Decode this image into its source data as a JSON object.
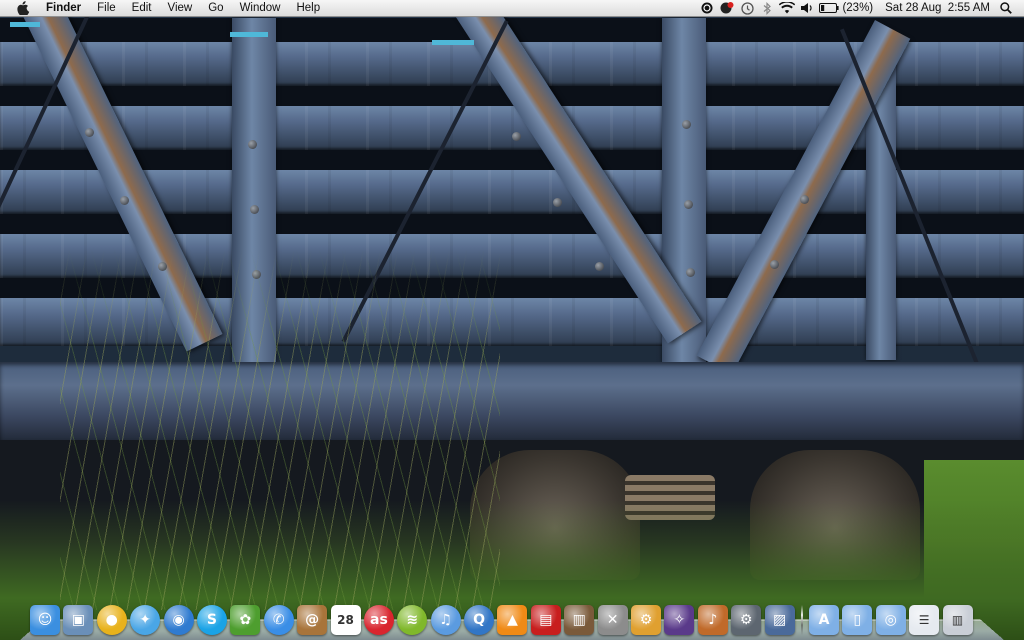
{
  "menubar": {
    "apple_icon": "apple-icon",
    "app_name": "Finder",
    "menus": [
      "File",
      "Edit",
      "View",
      "Go",
      "Window",
      "Help"
    ],
    "status_icons": [
      "record-icon",
      "alert-badge-icon",
      "time-machine-icon",
      "bluetooth-icon",
      "wifi-icon",
      "volume-icon"
    ],
    "battery_text": "(23%)",
    "battery_level": 0.23,
    "datetime": "Sat 28 Aug  2:55 AM",
    "spotlight_icon": "spotlight-icon"
  },
  "dock": {
    "apps": [
      {
        "icon": "finder-icon",
        "glyph": "☺",
        "bg": "#3b8fe0"
      },
      {
        "icon": "preview-icon",
        "glyph": "▣",
        "bg": "#6a8fb8"
      },
      {
        "icon": "chrome-icon",
        "glyph": "●",
        "bg": "#e8b21c"
      },
      {
        "icon": "safari-icon",
        "glyph": "✦",
        "bg": "#4aa6e6"
      },
      {
        "icon": "browser-globe-icon",
        "glyph": "◉",
        "bg": "#2f7bd0"
      },
      {
        "icon": "skype-icon",
        "glyph": "S",
        "bg": "#1aa3e6"
      },
      {
        "icon": "adium-icon",
        "glyph": "✿",
        "bg": "#4e9e2f"
      },
      {
        "icon": "messages-icon",
        "glyph": "✆",
        "bg": "#3a8ee6"
      },
      {
        "icon": "address-book-icon",
        "glyph": "@",
        "bg": "#a8743a"
      },
      {
        "icon": "calendar-icon",
        "glyph": "28",
        "bg": "#ffffff"
      },
      {
        "icon": "lastfm-icon",
        "glyph": "as",
        "bg": "#d9252e"
      },
      {
        "icon": "spotify-icon",
        "glyph": "≋",
        "bg": "#80b82b"
      },
      {
        "icon": "itunes-icon",
        "glyph": "♫",
        "bg": "#5b9be0"
      },
      {
        "icon": "quicktime-icon",
        "glyph": "Q",
        "bg": "#3276c6"
      },
      {
        "icon": "vlc-icon",
        "glyph": "▲",
        "bg": "#f08a16"
      },
      {
        "icon": "photo-booth-icon",
        "glyph": "▤",
        "bg": "#c81e1e"
      },
      {
        "icon": "iphoto-icon",
        "glyph": "▥",
        "bg": "#7a5a3a"
      },
      {
        "icon": "xcode-tools-icon",
        "glyph": "✕",
        "bg": "#8c8c8c"
      },
      {
        "icon": "system-preferences-icon",
        "glyph": "⚙",
        "bg": "#e0a030"
      },
      {
        "icon": "dashboard-icon",
        "glyph": "✧",
        "bg": "#5a3a8a"
      },
      {
        "icon": "guitar-icon",
        "glyph": "♪",
        "bg": "#c06a2a"
      },
      {
        "icon": "utility-gear-icon",
        "glyph": "⚙",
        "bg": "#5d6670"
      },
      {
        "icon": "contacts-photo-icon",
        "glyph": "▨",
        "bg": "#4a6a9a"
      }
    ],
    "stacks": [
      {
        "icon": "applications-folder-icon",
        "glyph": "A",
        "bg": "#7fb0e6"
      },
      {
        "icon": "documents-folder-icon",
        "glyph": "▯",
        "bg": "#7fb0e6"
      },
      {
        "icon": "downloads-folder-icon",
        "glyph": "◎",
        "bg": "#7fb0e6"
      },
      {
        "icon": "document-stack-icon",
        "glyph": "☰",
        "bg": "#e6eaf0"
      },
      {
        "icon": "trash-icon",
        "glyph": "▥",
        "bg": "#c9ced6"
      }
    ]
  }
}
